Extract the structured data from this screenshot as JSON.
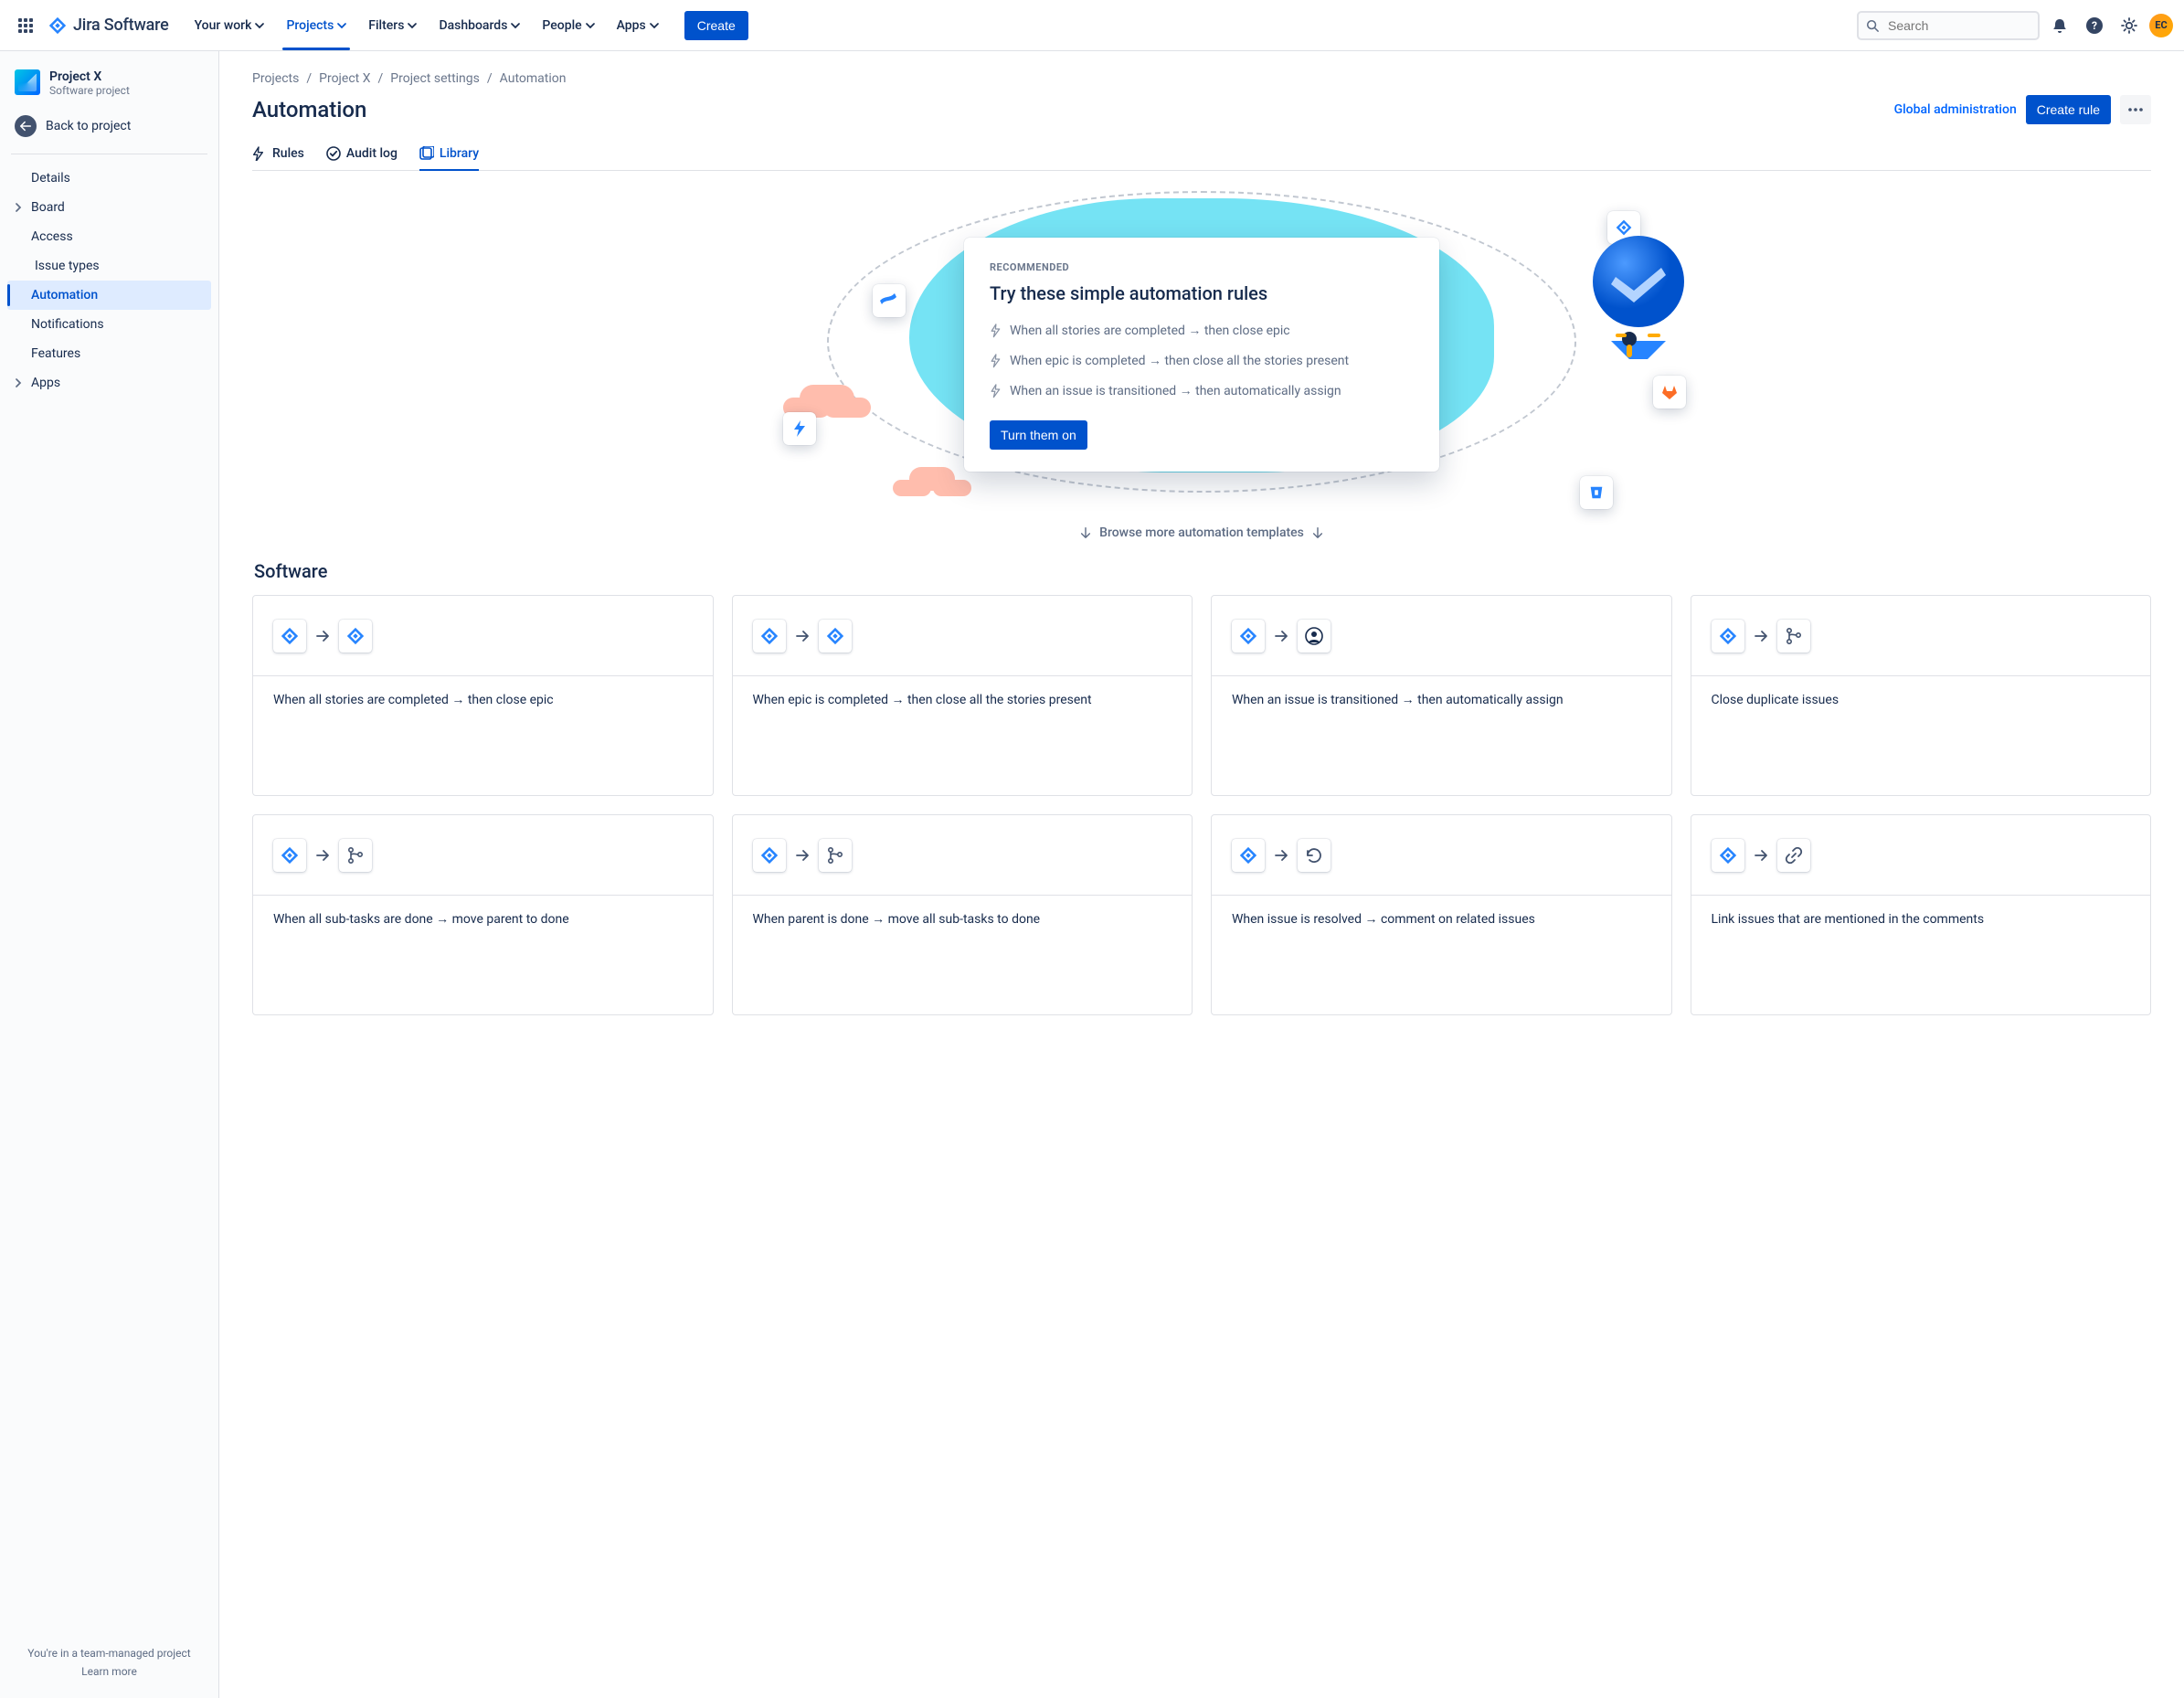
{
  "product": {
    "name": "Jira Software"
  },
  "topnav": {
    "items": [
      {
        "label": "Your work",
        "active": false
      },
      {
        "label": "Projects",
        "active": true
      },
      {
        "label": "Filters",
        "active": false
      },
      {
        "label": "Dashboards",
        "active": false
      },
      {
        "label": "People",
        "active": false
      },
      {
        "label": "Apps",
        "active": false
      }
    ],
    "create": "Create",
    "search_placeholder": "Search"
  },
  "avatar": {
    "initials": "EC"
  },
  "sidebar": {
    "project": {
      "name": "Project X",
      "type": "Software project"
    },
    "back": "Back to project",
    "items": [
      {
        "label": "Details",
        "selected": false,
        "expandable": false
      },
      {
        "label": "Board",
        "selected": false,
        "expandable": true
      },
      {
        "label": "Access",
        "selected": false,
        "expandable": false
      },
      {
        "label": "Issue types",
        "selected": false,
        "expandable": false,
        "indent": true
      },
      {
        "label": "Automation",
        "selected": true,
        "expandable": false
      },
      {
        "label": "Notifications",
        "selected": false,
        "expandable": false
      },
      {
        "label": "Features",
        "selected": false,
        "expandable": false
      },
      {
        "label": "Apps",
        "selected": false,
        "expandable": true
      }
    ],
    "footer": {
      "line1": "You're in a team-managed project",
      "learn_more": "Learn more"
    }
  },
  "breadcrumbs": [
    "Projects",
    "Project X",
    "Project settings",
    "Automation"
  ],
  "page": {
    "title": "Automation",
    "global_admin": "Global administration",
    "create_rule": "Create rule"
  },
  "tabs": [
    {
      "label": "Rules",
      "icon": "bolt",
      "active": false
    },
    {
      "label": "Audit log",
      "icon": "check",
      "active": false
    },
    {
      "label": "Library",
      "icon": "library",
      "active": true
    }
  ],
  "hero": {
    "eyebrow": "RECOMMENDED",
    "title": "Try these simple automation rules",
    "rules": [
      "When all stories are completed → then close epic",
      "When epic is completed → then close all the stories present",
      "When an issue is transitioned → then automatically assign"
    ],
    "cta": "Turn them on",
    "browse": "Browse more automation templates"
  },
  "templates": {
    "section_title": "Software",
    "cards": [
      {
        "icon2": "jira",
        "label": "When all stories are completed → then close epic"
      },
      {
        "icon2": "jira",
        "label": "When epic is completed → then close all the stories present"
      },
      {
        "icon2": "user",
        "label": "When an issue is transitioned → then automatically assign"
      },
      {
        "icon2": "branch",
        "label": "Close duplicate issues"
      },
      {
        "icon2": "branch",
        "label": "When all sub-tasks are done → move parent to done"
      },
      {
        "icon2": "branch",
        "label": "When parent is done → move all sub-tasks to done"
      },
      {
        "icon2": "refresh",
        "label": "When issue is resolved → comment on related issues"
      },
      {
        "icon2": "link",
        "label": "Link issues that are mentioned in the comments"
      }
    ]
  },
  "colors": {
    "jira_blue": "#2684FF",
    "branch_grey": "#42526E",
    "gitlab_orange": "#FC6D26",
    "bitbucket_blue": "#2684FF"
  }
}
